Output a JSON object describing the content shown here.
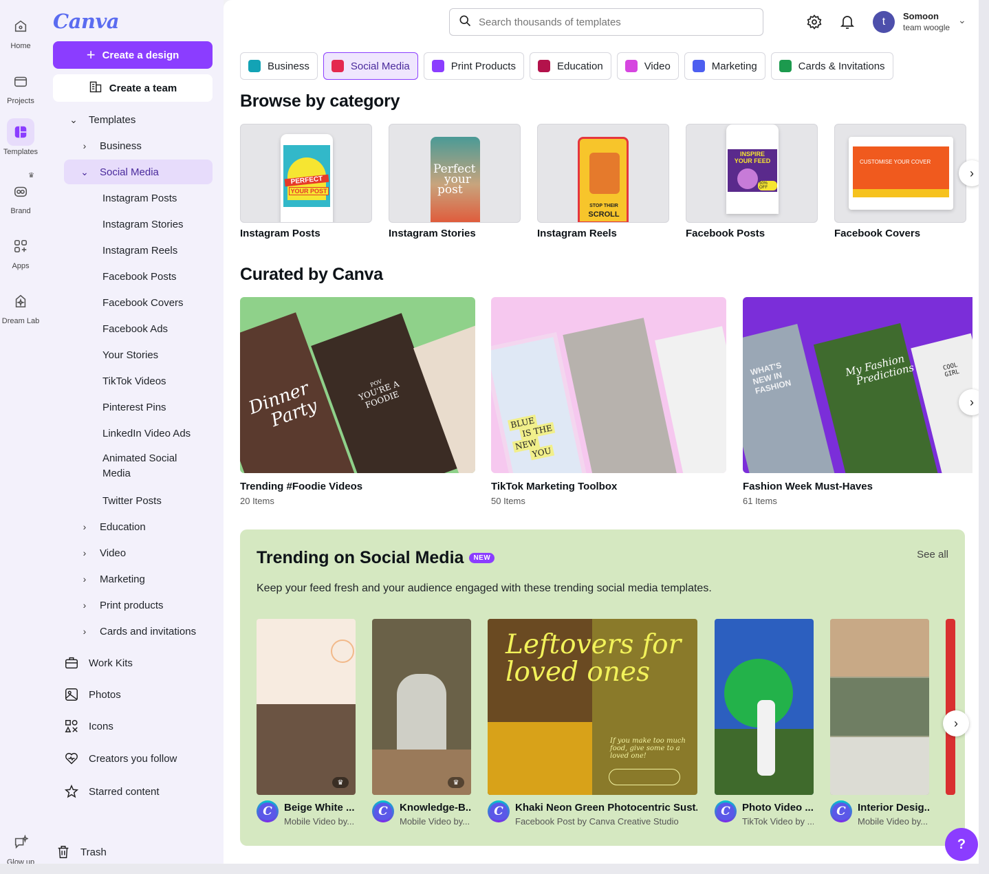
{
  "rail": [
    {
      "label": "Home",
      "icon": "home-icon"
    },
    {
      "label": "Projects",
      "icon": "folder-icon"
    },
    {
      "label": "Templates",
      "icon": "templates-icon"
    },
    {
      "label": "Brand",
      "icon": "brand-icon"
    },
    {
      "label": "Apps",
      "icon": "apps-icon"
    },
    {
      "label": "Dream Lab",
      "icon": "dream-lab-icon"
    },
    {
      "label": "Glow up",
      "icon": "glow-up-icon"
    }
  ],
  "sidebar": {
    "logo": "Canva",
    "create_design": "Create a design",
    "create_team": "Create a team",
    "templates_label": "Templates",
    "tree": [
      {
        "label": "Business"
      },
      {
        "label": "Social Media"
      },
      {
        "label": "Instagram Posts"
      },
      {
        "label": "Instagram Stories"
      },
      {
        "label": "Instagram Reels"
      },
      {
        "label": "Facebook Posts"
      },
      {
        "label": "Facebook Covers"
      },
      {
        "label": "Facebook Ads"
      },
      {
        "label": "Your Stories"
      },
      {
        "label": "TikTok Videos"
      },
      {
        "label": "Pinterest Pins"
      },
      {
        "label": "LinkedIn Video Ads"
      },
      {
        "label": "Animated Social Media"
      },
      {
        "label": "Twitter Posts"
      },
      {
        "label": "Education"
      },
      {
        "label": "Video"
      },
      {
        "label": "Marketing"
      },
      {
        "label": "Print products"
      },
      {
        "label": "Cards and invitations"
      }
    ],
    "links": [
      {
        "label": "Work Kits",
        "icon": "briefcase-icon"
      },
      {
        "label": "Photos",
        "icon": "photo-icon"
      },
      {
        "label": "Icons",
        "icon": "shapes-icon"
      },
      {
        "label": "Creators you follow",
        "icon": "heart-icon"
      },
      {
        "label": "Starred content",
        "icon": "star-icon"
      }
    ],
    "trash": "Trash"
  },
  "header": {
    "search_placeholder": "Search thousands of templates",
    "user_initial": "t",
    "user_name": "Somoon",
    "team_name": "team woogle"
  },
  "chips": [
    {
      "label": "Business",
      "color": "#13a3b5"
    },
    {
      "label": "Social Media",
      "color": "#e4284f"
    },
    {
      "label": "Print Products",
      "color": "#8b3dff"
    },
    {
      "label": "Education",
      "color": "#b3124b"
    },
    {
      "label": "Video",
      "color": "#d646e0"
    },
    {
      "label": "Marketing",
      "color": "#4d5ff0"
    },
    {
      "label": "Cards & Invitations",
      "color": "#1c9a4e"
    }
  ],
  "browse": {
    "title": "Browse by category",
    "items": [
      "Instagram Posts",
      "Instagram Stories",
      "Instagram Reels",
      "Facebook Posts",
      "Facebook Covers"
    ],
    "overlay_texts": {
      "ig_post": [
        "PERFECT",
        "YOUR POST"
      ],
      "ig_story": [
        "Perfect",
        "your",
        "post"
      ],
      "ig_reel": [
        "STOP THEIR",
        "SCROLL"
      ],
      "fb_post": [
        "INSPIRE",
        "YOUR FEED",
        "50% OFF"
      ],
      "fb_cover": [
        "CUSTOMISE YOUR COVER"
      ]
    }
  },
  "curated": {
    "title": "Curated by Canva",
    "items": [
      {
        "title": "Trending #Foodie Videos",
        "count": "20 Items",
        "overlay": [
          "Dinner",
          "Party",
          "POV",
          "YOU'RE A",
          "FOODIE"
        ]
      },
      {
        "title": "TikTok Marketing Toolbox",
        "count": "50 Items",
        "overlay": [
          "BLUE",
          "IS THE",
          "NEW",
          "YOU"
        ]
      },
      {
        "title": "Fashion Week Must-Haves",
        "count": "61 Items",
        "overlay": [
          "WHAT'S",
          "NEW IN",
          "FASHION",
          "My Fashion",
          "Predictions",
          "COOL GIRL"
        ]
      }
    ]
  },
  "trending": {
    "title": "Trending on Social Media",
    "badge": "NEW",
    "see_all": "See all",
    "description": "Keep your feed fresh and your audience engaged with these trending social media templates.",
    "items": [
      {
        "title": "Beige White ...",
        "sub": "Mobile Video by..."
      },
      {
        "title": "Knowledge-B...",
        "sub": "Mobile Video by..."
      },
      {
        "title": "Khaki Neon Green Photocentric Sust...",
        "sub": "Facebook Post by Canva Creative Studio",
        "overlay": [
          "Leftovers for",
          "loved ones",
          "If you make too much food, give some to a loved one!"
        ]
      },
      {
        "title": "Photo Video ...",
        "sub": "TikTok Video by ..."
      },
      {
        "title": "Interior Desig...",
        "sub": "Mobile Video by..."
      }
    ]
  },
  "help": "?"
}
